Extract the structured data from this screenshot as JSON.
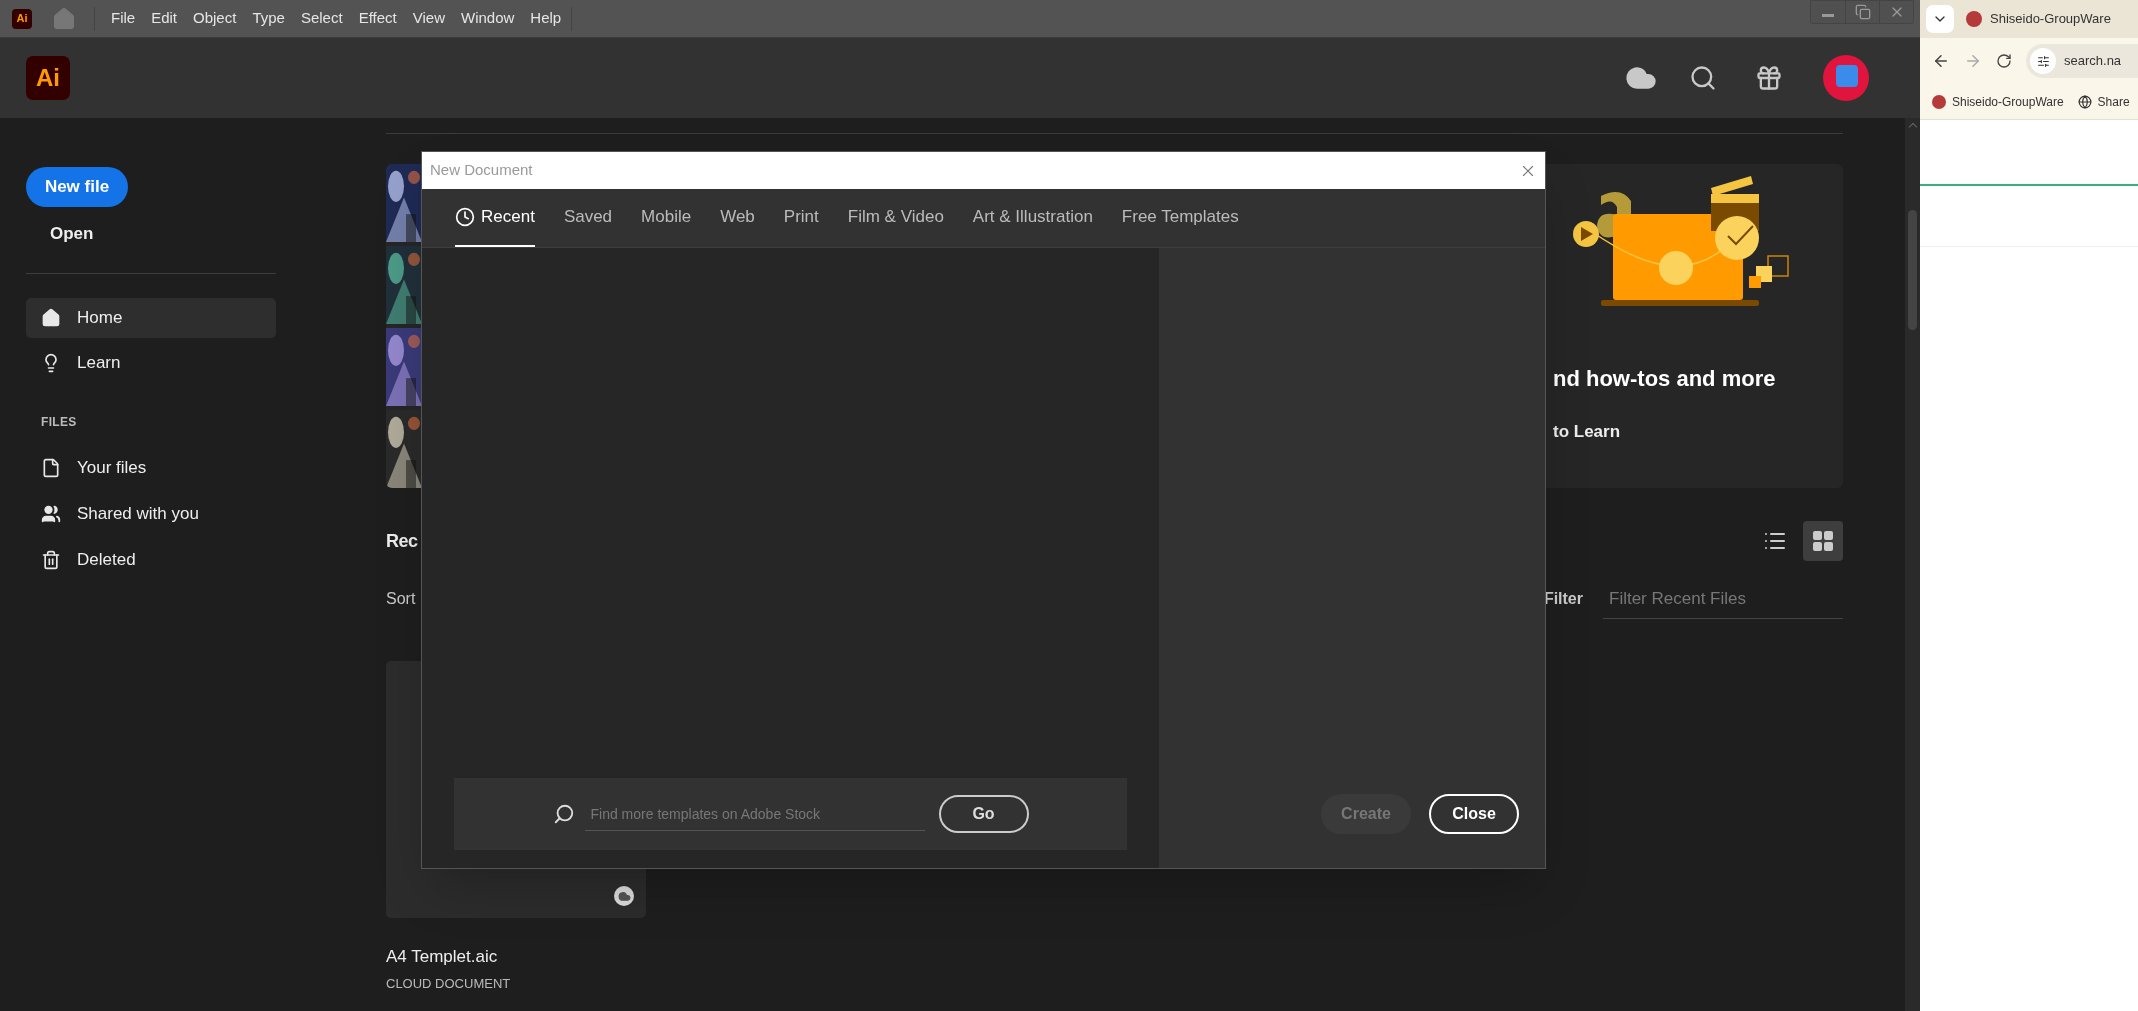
{
  "menu_bar": {
    "app_icon": "Ai",
    "items": [
      "File",
      "Edit",
      "Object",
      "Type",
      "Select",
      "Effect",
      "View",
      "Window",
      "Help"
    ]
  },
  "app_header": {
    "logo": "Ai"
  },
  "sidebar": {
    "new_file": "New file",
    "open": "Open",
    "nav": [
      {
        "label": "Home",
        "kind": "home",
        "selected": true
      },
      {
        "label": "Learn",
        "kind": "learn",
        "selected": false
      }
    ],
    "files_heading": "FILES",
    "files": [
      {
        "label": "Your files",
        "kind": "file"
      },
      {
        "label": "Shared with you",
        "kind": "people"
      },
      {
        "label": "Deleted",
        "kind": "trash"
      }
    ]
  },
  "hero": {
    "title": "nd how-tos and more",
    "link": "to Learn"
  },
  "recent": {
    "heading": "Rec",
    "sort_label": "Sort",
    "filter_label": "Filter",
    "filter_placeholder": "Filter Recent Files",
    "view_modes": [
      {
        "kind": "list",
        "selected": false
      },
      {
        "kind": "grid",
        "selected": true
      }
    ],
    "files": [
      {
        "name": "A4 Templet.aic",
        "type": "CLOUD DOCUMENT"
      }
    ]
  },
  "dialog": {
    "title": "New Document",
    "tabs": [
      {
        "label": "Recent",
        "kind": "history",
        "selected": true
      },
      {
        "label": "Saved",
        "kind": "text",
        "selected": false
      },
      {
        "label": "Mobile",
        "kind": "text",
        "selected": false
      },
      {
        "label": "Web",
        "kind": "text",
        "selected": false
      },
      {
        "label": "Print",
        "kind": "text",
        "selected": false
      },
      {
        "label": "Film & Video",
        "kind": "text",
        "selected": false
      },
      {
        "label": "Art & Illustration",
        "kind": "text",
        "selected": false
      },
      {
        "label": "Free Templates",
        "kind": "text",
        "selected": false
      }
    ],
    "search_placeholder": "Find more templates on Adobe Stock",
    "go": "Go",
    "buttons": [
      {
        "label": "Create",
        "disabled": true
      },
      {
        "label": "Close",
        "disabled": false
      }
    ]
  },
  "browser": {
    "tab_title": "Shiseido-GroupWare",
    "address": "search.na",
    "bookmarks": [
      {
        "label": "Shiseido-GroupWare",
        "kind": "site"
      },
      {
        "label": "Share",
        "kind": "globe"
      }
    ]
  }
}
